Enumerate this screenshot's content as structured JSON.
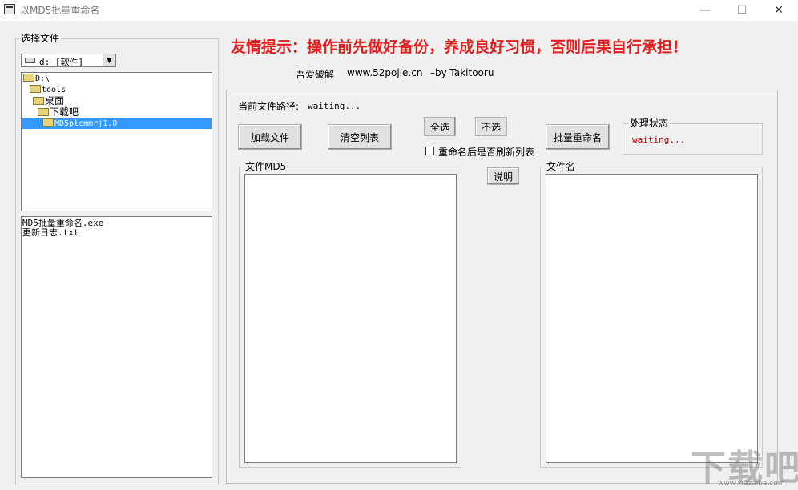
{
  "window": {
    "title": "以MD5批量重命名",
    "minimize": "—",
    "maximize": "☐",
    "close": "✕"
  },
  "left_panel": {
    "group_label": "选择文件",
    "drive_select_value": "d: [软件]",
    "tree": [
      "D:\\",
      "tools",
      "桌面",
      "下载吧",
      "MD5plcmmrj1.0"
    ],
    "files": [
      "MD5批量重命名.exe",
      "更新日志.txt"
    ]
  },
  "header": {
    "warning": "友情提示：操作前先做好备份，养成良好习惯，否则后果自行承担！",
    "credit_site_label": "吾爱破解",
    "credit_url": "www.52pojie.cn",
    "credit_by": "–by Takitooru"
  },
  "main": {
    "path_label": "当前文件路径:",
    "path_value": "waiting...",
    "load_button": "加载文件",
    "clear_button": "清空列表",
    "select_all_button": "全选",
    "deselect_button": "不选",
    "refresh_checkbox_label": "重命名后是否刷新列表",
    "batch_rename_button": "批量重命名",
    "status_group_label": "处理状态",
    "status_value": "waiting...",
    "md5_group_label": "文件MD5",
    "help_button": "说明",
    "filename_group_label": "文件名"
  },
  "watermark": {
    "brand": "下载吧",
    "url": "www.xiazaiba.com"
  },
  "colors": {
    "warning": "#e01e1e",
    "status_text": "#c00000",
    "selection": "#3399ff"
  }
}
